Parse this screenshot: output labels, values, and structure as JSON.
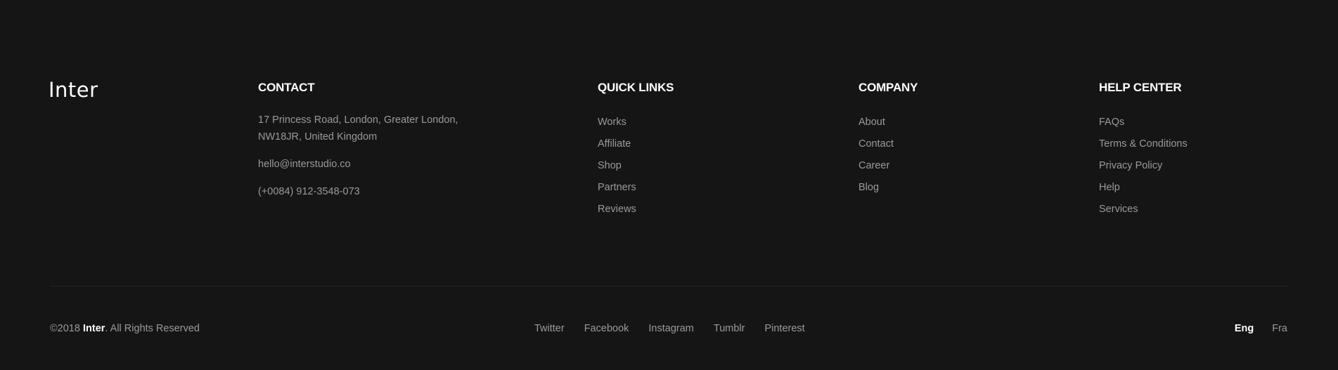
{
  "brand": {
    "logo": "Inter"
  },
  "contact": {
    "title": "CONTACT",
    "address_line1": "17 Princess Road, London, Greater London,",
    "address_line2": "NW18JR, United Kingdom",
    "email": "hello@interstudio.co",
    "phone": "(+0084) 912-3548-073"
  },
  "quick_links": {
    "title": "QUICK LINKS",
    "items": [
      "Works",
      "Affiliate",
      "Shop",
      "Partners",
      "Reviews"
    ]
  },
  "company": {
    "title": "COMPANY",
    "items": [
      "About",
      "Contact",
      "Career",
      "Blog"
    ]
  },
  "help_center": {
    "title": "HELP CENTER",
    "items": [
      "FAQs",
      "Terms & Conditions",
      "Privacy Policy",
      "Help",
      "Services"
    ]
  },
  "footer": {
    "copyright_prefix": "©2018 ",
    "copyright_brand": "Inter",
    "copyright_suffix": ". All Rights Reserved",
    "social": [
      "Twitter",
      "Facebook",
      "Instagram",
      "Tumblr",
      "Pinterest"
    ],
    "languages": [
      "Eng",
      "Fra"
    ],
    "active_language": "Eng"
  },
  "colors": {
    "background": "#151515",
    "heading": "#ffffff",
    "text": "#9a9a9a",
    "divider": "#262626"
  }
}
